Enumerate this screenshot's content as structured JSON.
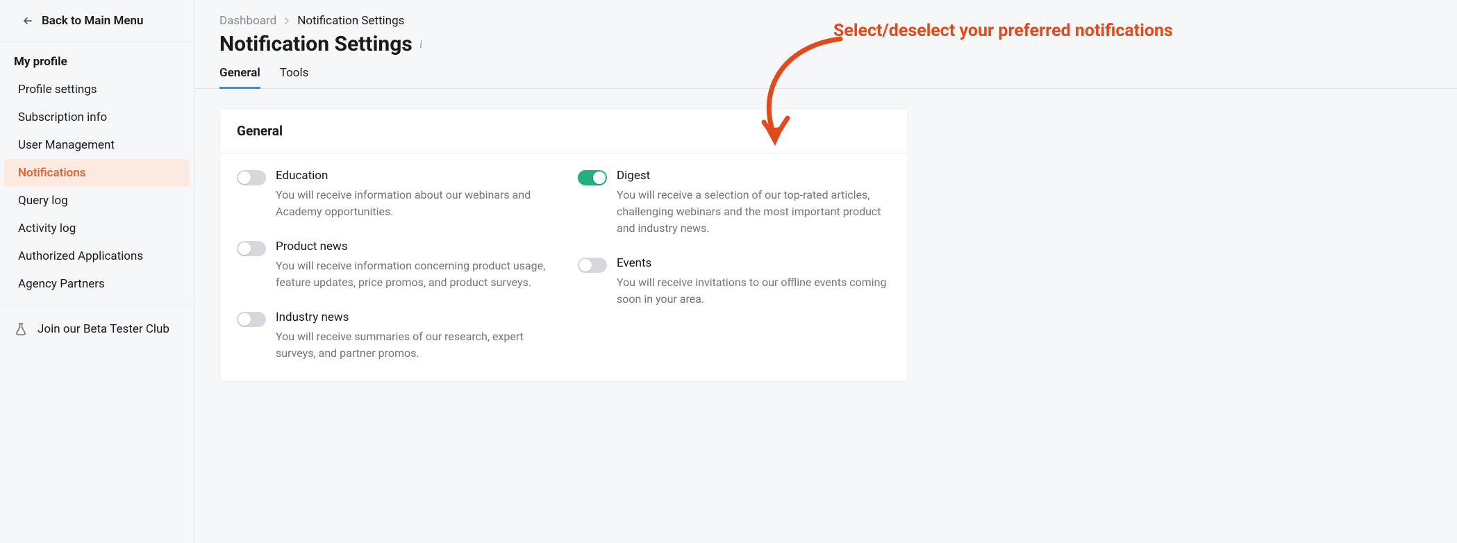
{
  "sidebar": {
    "back_label": "Back to Main Menu",
    "section_title": "My profile",
    "items": [
      {
        "label": "Profile settings"
      },
      {
        "label": "Subscription info"
      },
      {
        "label": "User Management"
      },
      {
        "label": "Notifications"
      },
      {
        "label": "Query log"
      },
      {
        "label": "Activity log"
      },
      {
        "label": "Authorized Applications"
      },
      {
        "label": "Agency Partners"
      }
    ],
    "beta_label": "Join our Beta Tester Club"
  },
  "breadcrumb": {
    "root": "Dashboard",
    "current": "Notification Settings"
  },
  "page_title": "Notification Settings",
  "tabs": {
    "general": "General",
    "tools": "Tools"
  },
  "card": {
    "heading": "General",
    "left": [
      {
        "title": "Education",
        "desc": "You will receive information about our webinars and Academy opportunities.",
        "on": false
      },
      {
        "title": "Product news",
        "desc": "You will receive information concerning product usage, feature updates, price promos, and product surveys.",
        "on": false
      },
      {
        "title": "Industry news",
        "desc": "You will receive summaries of our research, expert surveys, and partner promos.",
        "on": false
      }
    ],
    "right": [
      {
        "title": "Digest",
        "desc": "You will receive a selection of our top-rated articles, challenging webinars and the most important product and industry news.",
        "on": true
      },
      {
        "title": "Events",
        "desc": "You will receive invitations to our offline events coming soon in your area.",
        "on": false
      }
    ]
  },
  "annotation": "Select/deselect your preferred notifications"
}
